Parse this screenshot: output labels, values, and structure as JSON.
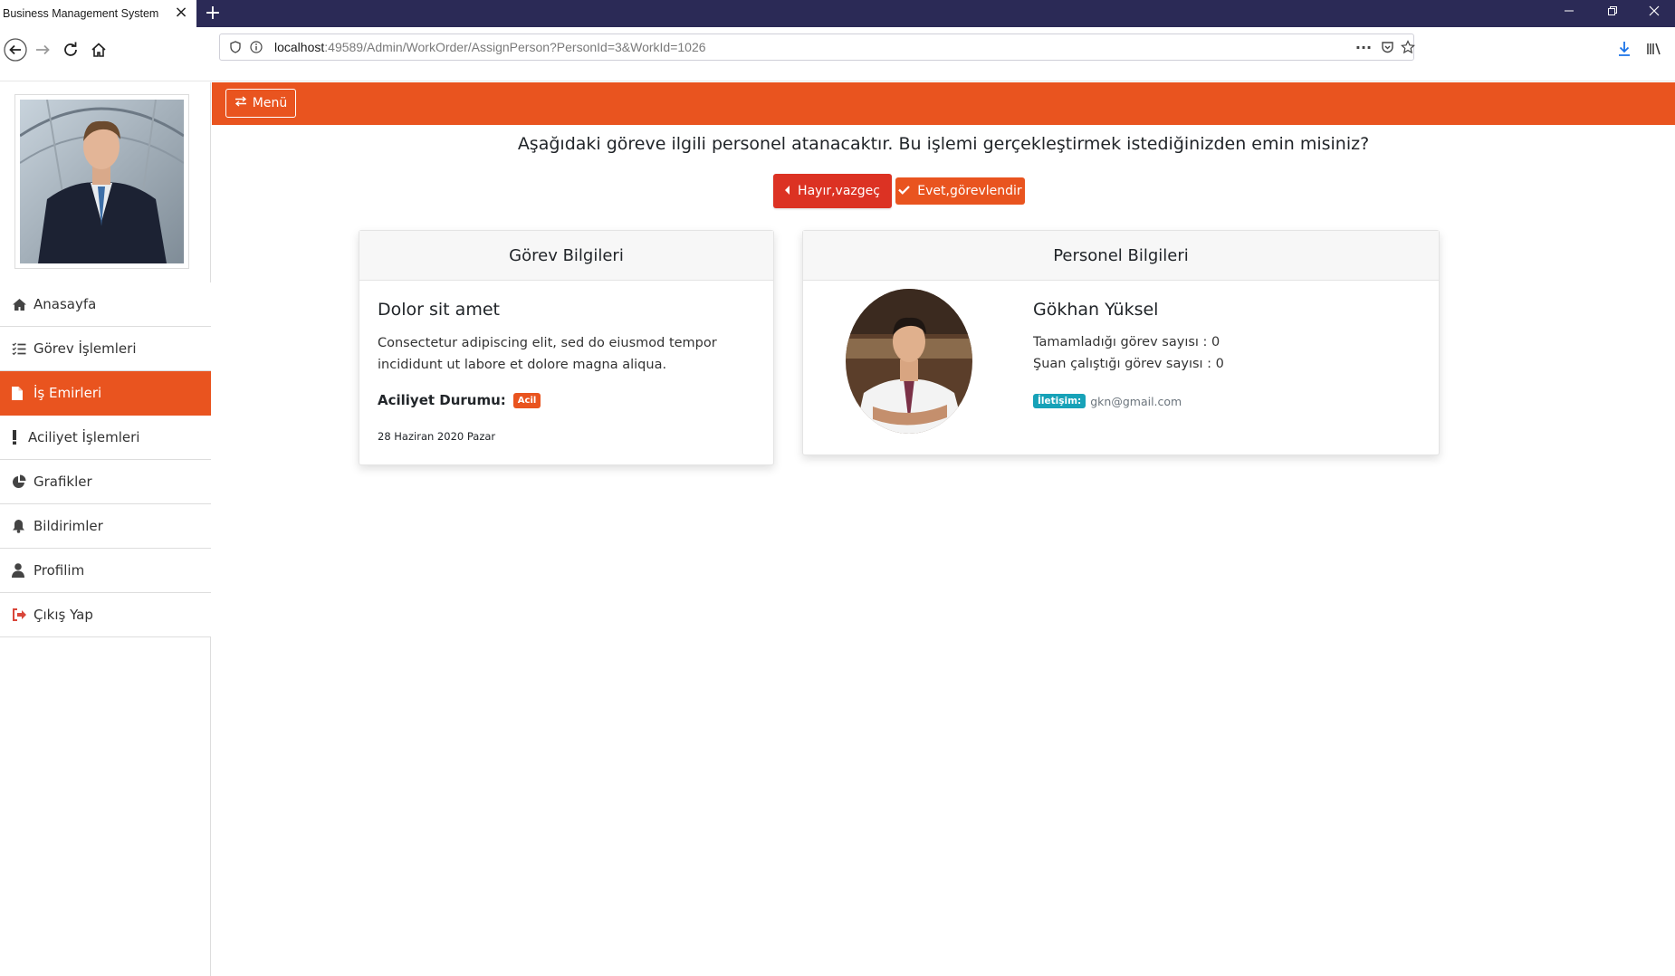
{
  "browser": {
    "tab_title": "Business Management System",
    "url_host": "localhost",
    "url_rest": ":49589/Admin/WorkOrder/AssignPerson?PersonId=3&WorkId=1026"
  },
  "sidebar": {
    "items": [
      {
        "label": "Anasayfa",
        "icon": "home-icon"
      },
      {
        "label": "Görev İşlemleri",
        "icon": "tasks-icon"
      },
      {
        "label": "İş Emirleri",
        "icon": "file-icon"
      },
      {
        "label": "Aciliyet İşlemleri",
        "icon": "exclamation-icon"
      },
      {
        "label": "Grafikler",
        "icon": "pie-chart-icon"
      },
      {
        "label": "Bildirimler",
        "icon": "bell-icon"
      },
      {
        "label": "Profilim",
        "icon": "user-icon"
      },
      {
        "label": "Çıkış Yap",
        "icon": "sign-out-icon"
      }
    ],
    "active_index": 2
  },
  "topbar": {
    "menu_label": "Menü"
  },
  "page": {
    "question": "Aşağıdaki göreve ilgili personel atanacaktır. Bu işlemi gerçekleştirmek istediğinizden emin misiniz?",
    "cancel_label": "Hayır,vazgeç",
    "confirm_label": "Evet,görevlendir"
  },
  "task_card": {
    "header": "Görev Bilgileri",
    "title": "Dolor sit amet",
    "description": "Consectetur adipiscing elit, sed do eiusmod tempor incididunt ut labore et dolore magna aliqua.",
    "urgency_label": "Aciliyet Durumu:",
    "urgency_value": "Acil",
    "date": "28 Haziran 2020 Pazar"
  },
  "person_card": {
    "header": "Personel Bilgileri",
    "name": "Gökhan Yüksel",
    "completed": "Tamamladığı görev sayısı : 0",
    "current": "Şuan çalıştığı görev sayısı : 0",
    "contact_label": "İletişim:",
    "email": "gkn@gmail.com"
  },
  "colors": {
    "accent": "#e9541f",
    "danger": "#dc3223",
    "info": "#17a2b8",
    "chrome": "#2b2a56"
  }
}
